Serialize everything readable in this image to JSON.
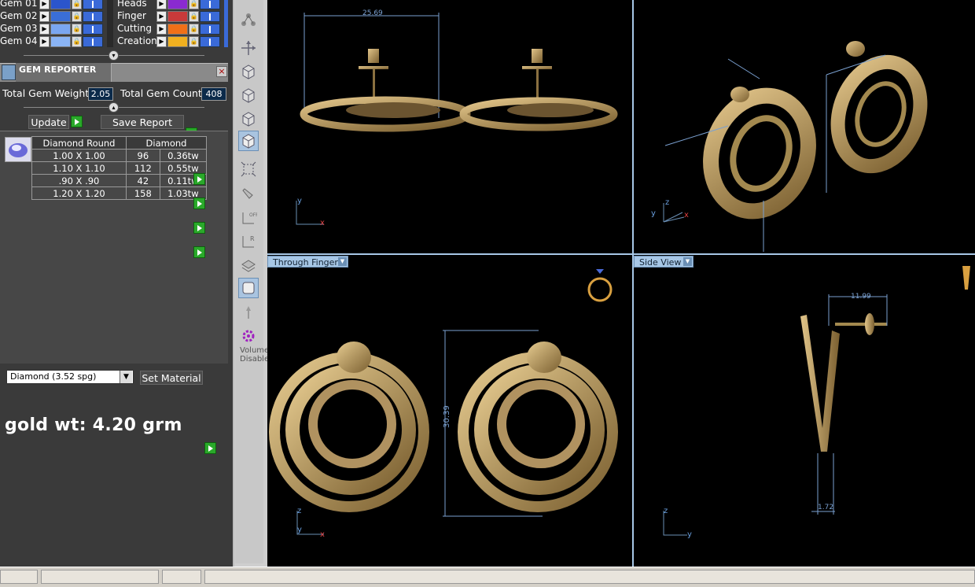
{
  "gem_layers": [
    {
      "label": "Gem 01",
      "color": "#2b55cc"
    },
    {
      "label": "Gem 02",
      "color": "#3a6ed6"
    },
    {
      "label": "Gem 03",
      "color": "#7aa6f0"
    },
    {
      "label": "Gem 04",
      "color": "#8ab4f5"
    }
  ],
  "material_layers": [
    {
      "label": "Heads",
      "color": "#8a2ad0"
    },
    {
      "label": "Finger",
      "color": "#c83a3a"
    },
    {
      "label": "Cutting",
      "color": "#f07018"
    },
    {
      "label": "Creation",
      "color": "#f0b020"
    }
  ],
  "gem_reporter": {
    "title": "GEM REPORTER",
    "close": "×",
    "total_weight_label": "Total Gem Weight",
    "total_weight_value": "2.05",
    "total_count_label": "Total Gem Count",
    "total_count_value": "408",
    "update_label": "Update",
    "save_report_label": "Save Report",
    "table": {
      "headers": [
        "Diamond Round",
        "Diamond"
      ],
      "rows": [
        {
          "size": "1.00 X 1.00",
          "count": "96",
          "weight": "0.36tw"
        },
        {
          "size": "1.10 X 1.10",
          "count": "112",
          "weight": "0.55tw"
        },
        {
          "size": ".90 X .90",
          "count": "42",
          "weight": "0.11tw"
        },
        {
          "size": "1.20 X 1.20",
          "count": "158",
          "weight": "1.03tw"
        }
      ]
    },
    "material_select": "Diamond    (3.52 spg)",
    "set_material_label": "Set Material"
  },
  "gold_weight": "gold wt: 4.20 grm",
  "toolbar": {
    "volume_text": "Volume Disabled"
  },
  "viewports": {
    "bottom_left_tab": "Through Finger",
    "bottom_right_tab": "Side View",
    "dims": {
      "top_left": "25.69",
      "bottom_left": "30.39",
      "bottom_right_top": "11.99",
      "bottom_right_bottom": "1.72"
    },
    "axes": {
      "x": "x",
      "y": "y",
      "z": "z"
    }
  },
  "colors": {
    "gold": "#b99a5e",
    "viewport_bg": "#000000",
    "dim_line": "#7aa0d0",
    "tab_bg": "#a7c7e6"
  }
}
